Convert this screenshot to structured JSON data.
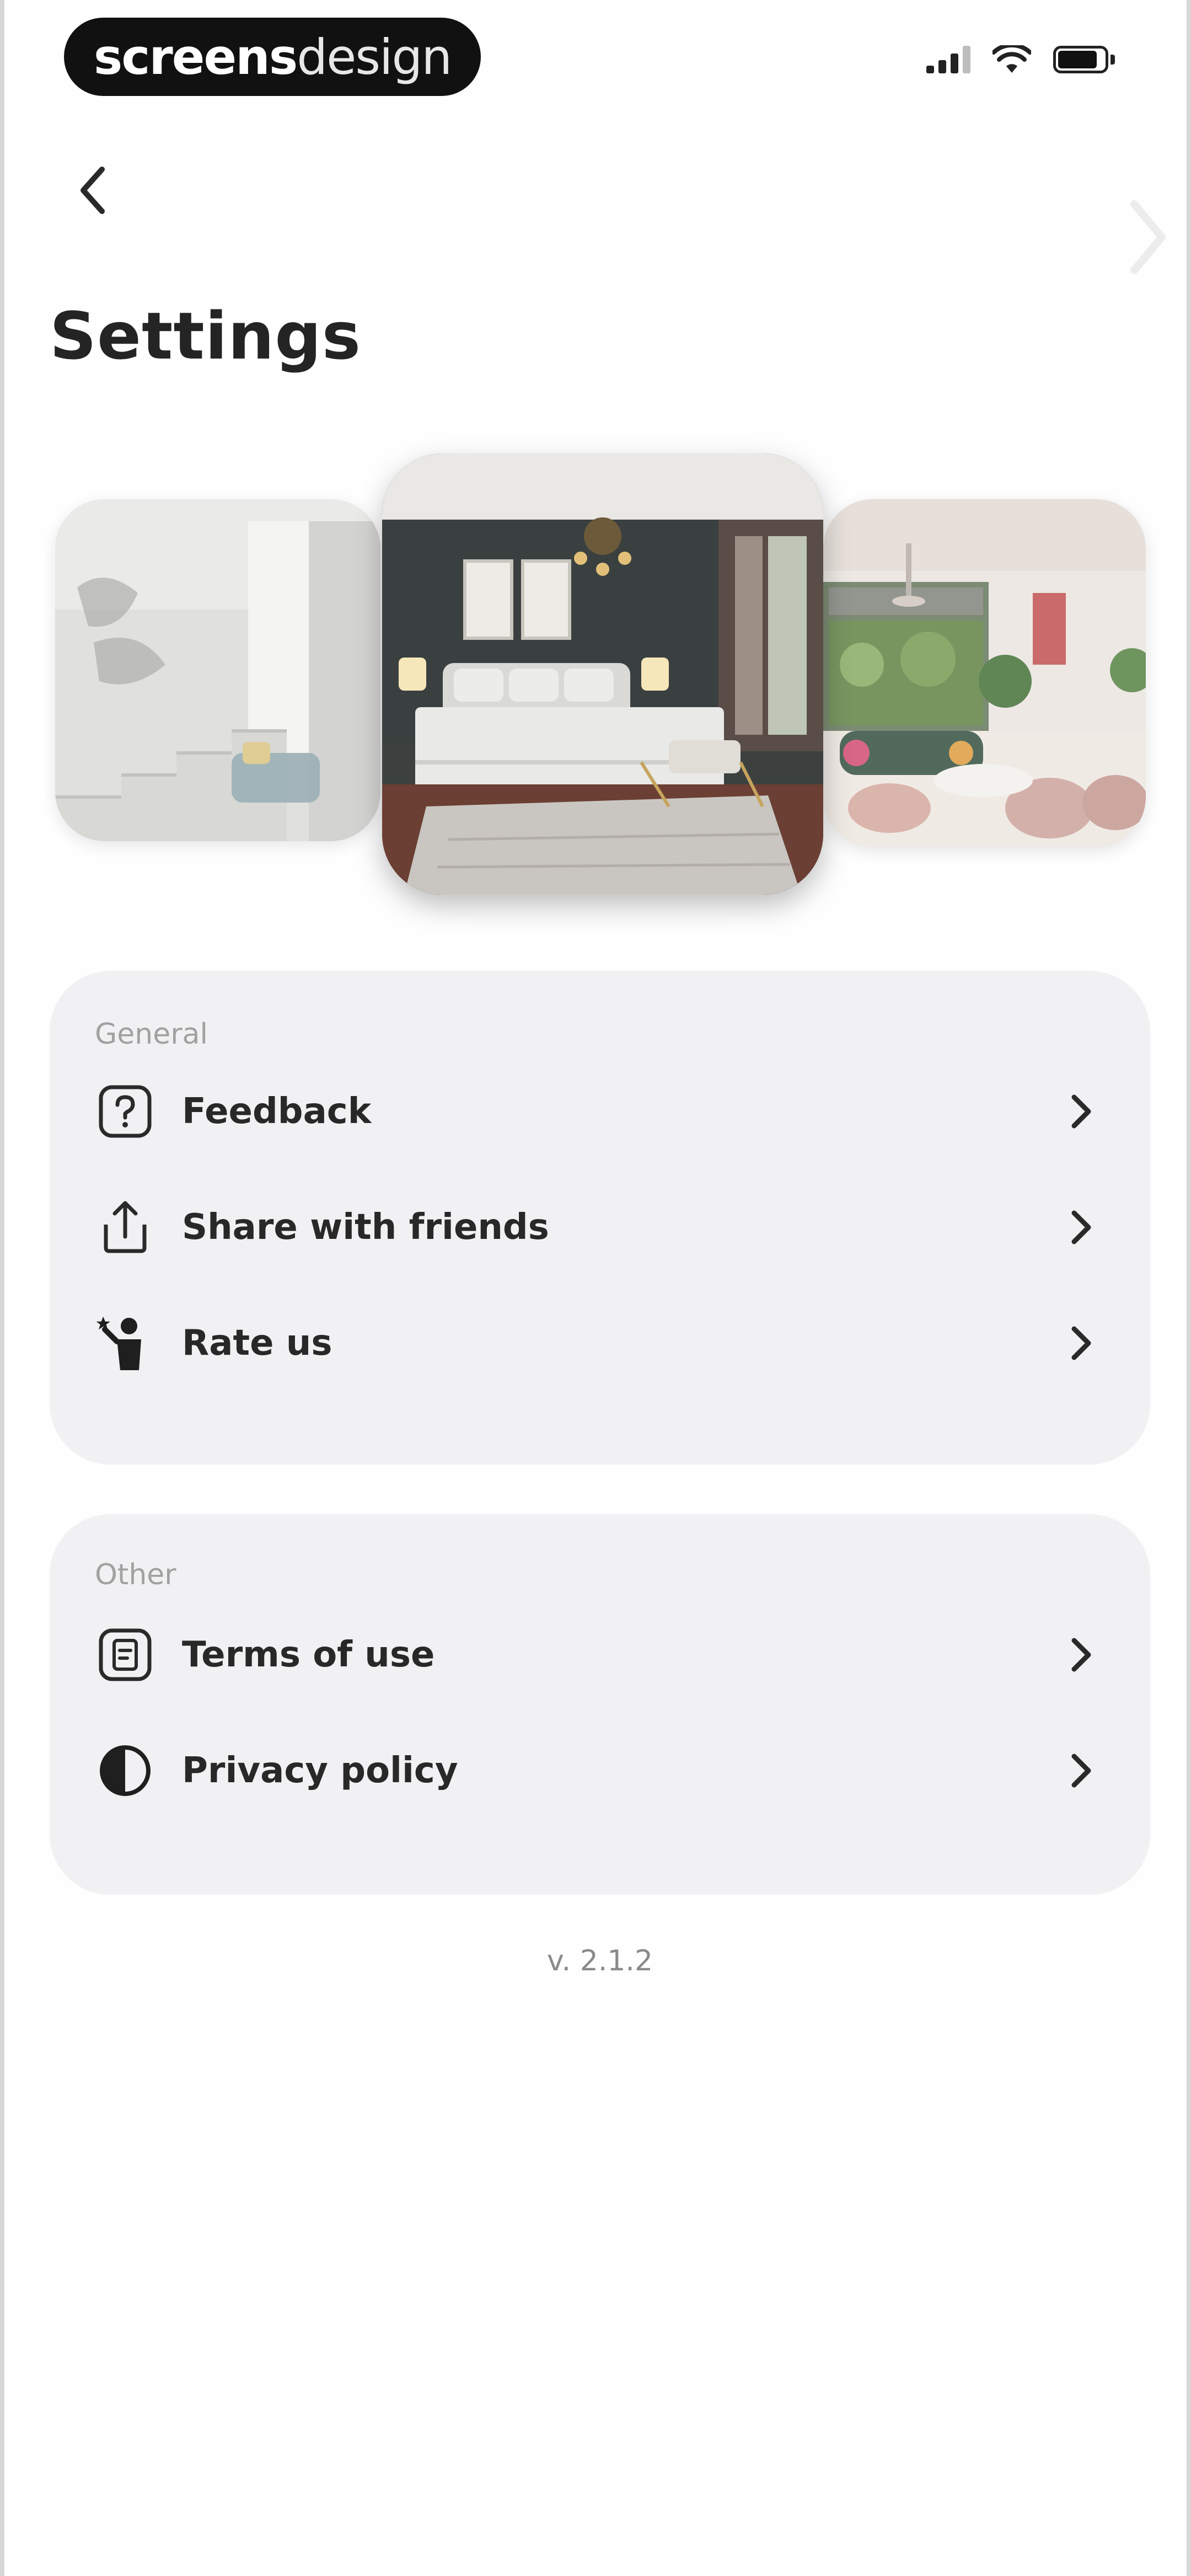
{
  "status_bar": {
    "brand_bold": "screens",
    "brand_light": "design",
    "icons": [
      "signal-icon",
      "wifi-icon",
      "battery-icon"
    ]
  },
  "header": {
    "back_icon": "chevron-left-icon",
    "title": "Settings"
  },
  "carousel": {
    "cards": [
      {
        "name": "staircase-room"
      },
      {
        "name": "bedroom"
      },
      {
        "name": "living-room"
      }
    ]
  },
  "general": {
    "label": "General",
    "items": [
      {
        "label": "Feedback",
        "icon": "question-square-icon"
      },
      {
        "label": "Share with friends",
        "icon": "share-icon"
      },
      {
        "label": "Rate us",
        "icon": "rate-icon"
      }
    ]
  },
  "other": {
    "label": "Other",
    "items": [
      {
        "label": "Terms of use",
        "icon": "document-icon"
      },
      {
        "label": "Privacy policy",
        "icon": "half-circle-icon"
      }
    ]
  },
  "footer": {
    "version": "v. 2.1.2"
  },
  "colors": {
    "background": "#fefefe",
    "card_background": "#f1f1f3",
    "text": "#282828",
    "muted": "#a1a1a1"
  }
}
